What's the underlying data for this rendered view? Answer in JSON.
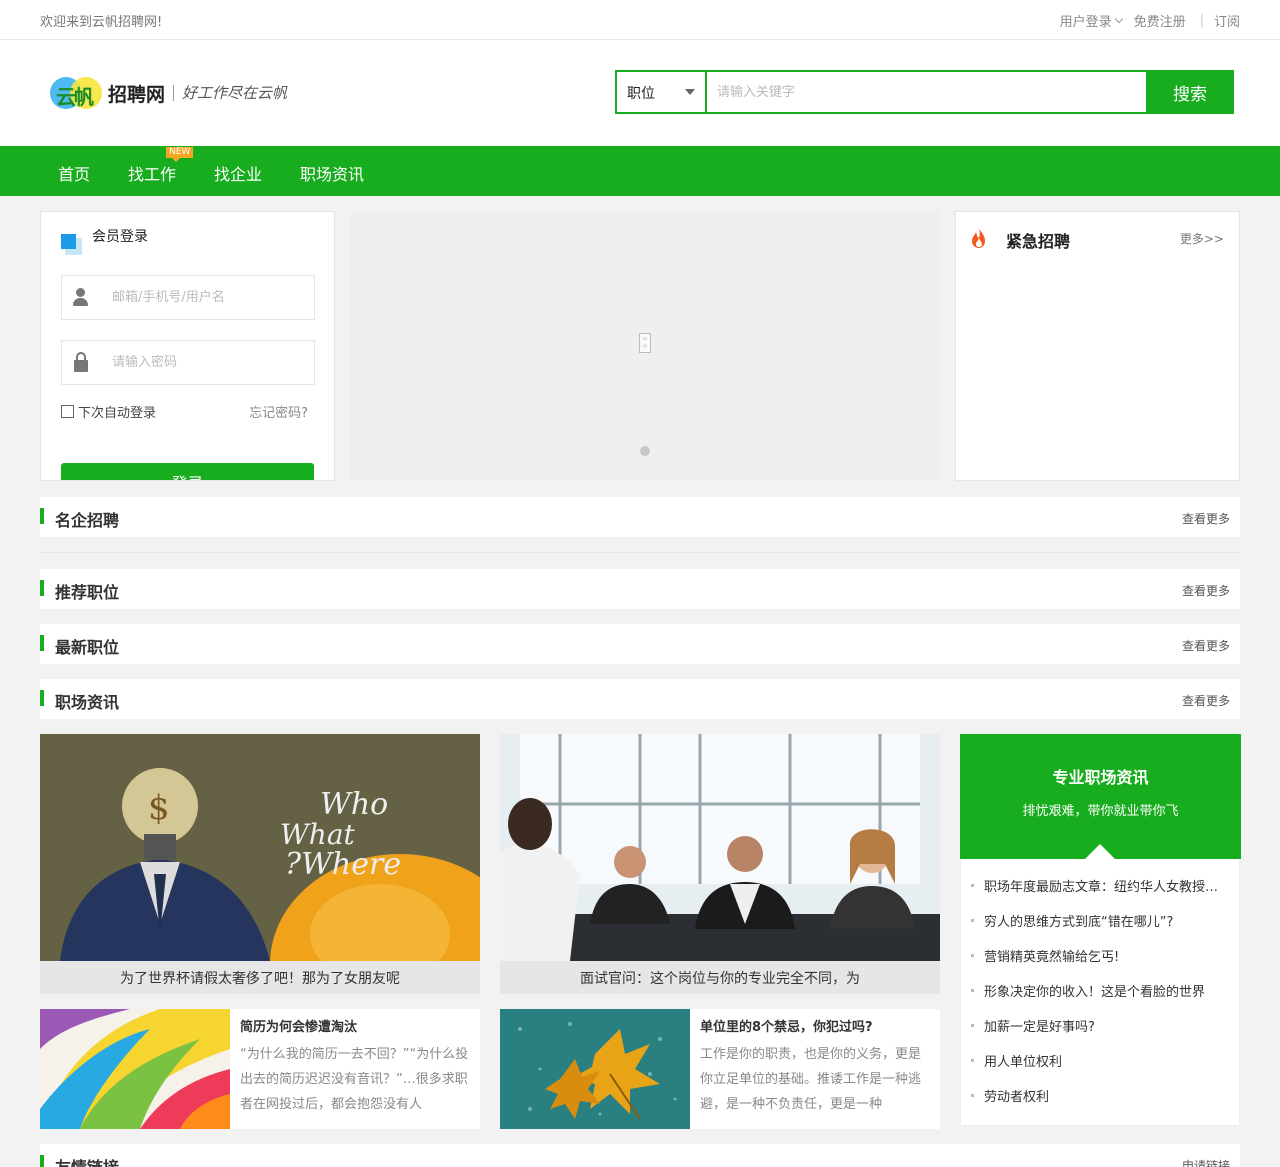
{
  "topbar": {
    "welcome": "欢迎来到云帆招聘网!",
    "login": "用户登录",
    "register": "免费注册",
    "separator": "|",
    "subscribe": "订阅"
  },
  "logo": {
    "mark": "云帆",
    "name": "招聘网",
    "slogan": "好工作尽在云帆"
  },
  "search": {
    "category": "职位",
    "placeholder": "请输入关键字",
    "button": "搜索"
  },
  "nav": {
    "items": [
      "首页",
      "找工作",
      "找企业",
      "职场资讯"
    ],
    "badge": "NEW"
  },
  "login": {
    "title": "会员登录",
    "username_placeholder": "邮箱/手机号/用户名",
    "password_placeholder": "请输入密码",
    "remember": "下次自动登录",
    "forgot": "忘记密码?",
    "submit": "登录"
  },
  "urgent": {
    "title": "紧急招聘",
    "more": "更多>>"
  },
  "sections": {
    "famous": {
      "title": "名企招聘",
      "more": "查看更多"
    },
    "recommend": {
      "title": "推荐职位",
      "more": "查看更多"
    },
    "latest": {
      "title": "最新职位",
      "more": "查看更多"
    },
    "news": {
      "title": "职场资讯",
      "more": "查看更多"
    },
    "links": {
      "title": "友情链接",
      "more": "申请链接"
    }
  },
  "articles": {
    "feature": [
      {
        "caption": "为了世界杯请假太奢侈了吧！那为了女朋友呢"
      },
      {
        "caption": "面试官问：这个岗位与你的专业完全不同，为"
      }
    ],
    "list": [
      {
        "title": "简历为何会惨遭淘汰",
        "summary": "“为什么我的简历一去不回？”“为什么投出去的简历迟迟没有音讯？”…很多求职者在网投过后，都会抱怨没有人"
      },
      {
        "title": "单位里的8个禁忌，你犯过吗?",
        "summary": "工作是你的职责，也是你的义务，更是你立足单位的基础。推诿工作是一种逃避，是一种不负责任，更是一种"
      }
    ]
  },
  "side_news": {
    "title": "专业职场资讯",
    "subtitle": "排忧艰难，带你就业带你飞",
    "items": [
      "职场年度最励志文章：纽约华人女教授的职业规划",
      "穷人的思维方式到底“错在哪儿”?",
      "营销精英竟然输给乞丐!",
      "形象决定你的收入！这是个看脸的世界",
      "加薪一定是好事吗?",
      "用人单位权利",
      "劳动者权利"
    ]
  },
  "colors": {
    "brand": "#17ad1e",
    "badge": "#f5a623",
    "login_icon": "#1e9be8"
  },
  "icons": {
    "user": "user-icon",
    "lock": "lock-icon",
    "fire": "fire-icon",
    "chevron": "chevron-down-icon"
  }
}
